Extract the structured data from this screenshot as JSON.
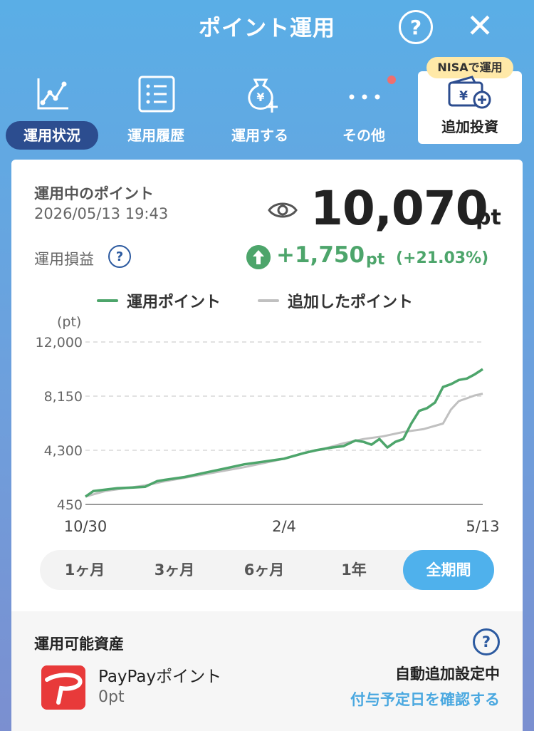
{
  "header": {
    "title": "ポイント運用",
    "help": "?",
    "close": "✕"
  },
  "nav": {
    "items": [
      {
        "label": "運用状況",
        "icon": "line-chart-icon",
        "active": true
      },
      {
        "label": "運用履歴",
        "icon": "list-icon",
        "active": false
      },
      {
        "label": "運用する",
        "icon": "yen-bag-plus-icon",
        "active": false
      },
      {
        "label": "その他",
        "icon": "more-dots-icon",
        "active": false
      }
    ],
    "nisa": {
      "badge": "NISAで運用",
      "label": "追加投資",
      "icon": "wallet-yen-plus-icon"
    }
  },
  "summary": {
    "points_label": "運用中のポイント",
    "timestamp": "2026/05/13 19:43",
    "value": "10,070",
    "unit": "pt",
    "profit_label": "運用損益",
    "profit_help": "?",
    "profit_value": "+1,750",
    "profit_unit": "pt",
    "profit_pct": "(+21.03%)"
  },
  "chart_data": {
    "type": "line",
    "ylabel": "(pt)",
    "ylim": [
      450,
      12000
    ],
    "yticks": [
      "12,000",
      "8,150",
      "4,300",
      "450"
    ],
    "ytick_values": [
      12000,
      8150,
      4300,
      450
    ],
    "xtick_labels": [
      "10/30",
      "2/4",
      "5/13"
    ],
    "xtick_positions": [
      0,
      0.5,
      1
    ],
    "legend": [
      "運用ポイント",
      "追加したポイント"
    ],
    "series": [
      {
        "name": "運用ポイント",
        "color": "#4da56b",
        "x": [
          0,
          0.02,
          0.05,
          0.08,
          0.12,
          0.15,
          0.18,
          0.2,
          0.25,
          0.3,
          0.35,
          0.4,
          0.45,
          0.5,
          0.55,
          0.58,
          0.62,
          0.65,
          0.68,
          0.7,
          0.72,
          0.74,
          0.76,
          0.78,
          0.8,
          0.82,
          0.84,
          0.86,
          0.88,
          0.9,
          0.92,
          0.94,
          0.96,
          0.98,
          1.0
        ],
        "values": [
          1000,
          1400,
          1500,
          1600,
          1650,
          1700,
          2100,
          2200,
          2400,
          2700,
          3000,
          3300,
          3500,
          3700,
          4100,
          4300,
          4500,
          4600,
          5000,
          4900,
          4700,
          5100,
          4500,
          4900,
          5100,
          6200,
          7100,
          7300,
          7700,
          8800,
          9000,
          9300,
          9400,
          9700,
          10070
        ]
      },
      {
        "name": "追加したポイント",
        "color": "#c0c0c0",
        "x": [
          0,
          0.05,
          0.1,
          0.15,
          0.2,
          0.25,
          0.3,
          0.35,
          0.4,
          0.45,
          0.5,
          0.55,
          0.6,
          0.65,
          0.7,
          0.75,
          0.8,
          0.85,
          0.9,
          0.92,
          0.94,
          0.96,
          0.98,
          1.0
        ],
        "values": [
          1000,
          1400,
          1600,
          1800,
          2100,
          2350,
          2600,
          2850,
          3100,
          3400,
          3700,
          4100,
          4400,
          4800,
          5100,
          5300,
          5600,
          5800,
          6200,
          7200,
          7800,
          8000,
          8200,
          8320
        ]
      }
    ]
  },
  "periods": {
    "items": [
      "1ヶ月",
      "3ヶ月",
      "6ヶ月",
      "1年",
      "全期間"
    ],
    "selected": "全期間"
  },
  "asset": {
    "title": "運用可能資産",
    "help": "?",
    "name": "PayPayポイント",
    "value": "0pt",
    "auto_setting": "自動追加設定中",
    "confirm_link": "付与予定日を確認する"
  }
}
